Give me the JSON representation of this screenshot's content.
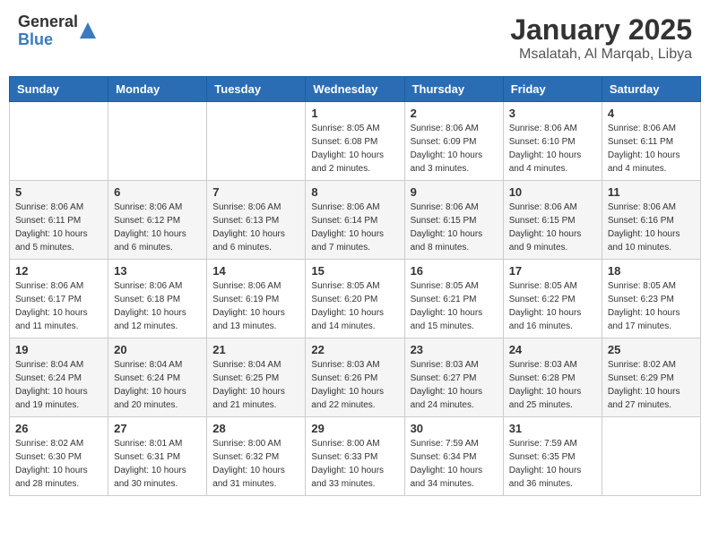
{
  "header": {
    "logo": {
      "line1": "General",
      "line2": "Blue"
    },
    "title": "January 2025",
    "subtitle": "Msalatah, Al Marqab, Libya"
  },
  "weekdays": [
    "Sunday",
    "Monday",
    "Tuesday",
    "Wednesday",
    "Thursday",
    "Friday",
    "Saturday"
  ],
  "weeks": [
    [
      {
        "day": "",
        "sunrise": "",
        "sunset": "",
        "daylight": ""
      },
      {
        "day": "",
        "sunrise": "",
        "sunset": "",
        "daylight": ""
      },
      {
        "day": "",
        "sunrise": "",
        "sunset": "",
        "daylight": ""
      },
      {
        "day": "1",
        "sunrise": "Sunrise: 8:05 AM",
        "sunset": "Sunset: 6:08 PM",
        "daylight": "Daylight: 10 hours and 2 minutes."
      },
      {
        "day": "2",
        "sunrise": "Sunrise: 8:06 AM",
        "sunset": "Sunset: 6:09 PM",
        "daylight": "Daylight: 10 hours and 3 minutes."
      },
      {
        "day": "3",
        "sunrise": "Sunrise: 8:06 AM",
        "sunset": "Sunset: 6:10 PM",
        "daylight": "Daylight: 10 hours and 4 minutes."
      },
      {
        "day": "4",
        "sunrise": "Sunrise: 8:06 AM",
        "sunset": "Sunset: 6:11 PM",
        "daylight": "Daylight: 10 hours and 4 minutes."
      }
    ],
    [
      {
        "day": "5",
        "sunrise": "Sunrise: 8:06 AM",
        "sunset": "Sunset: 6:11 PM",
        "daylight": "Daylight: 10 hours and 5 minutes."
      },
      {
        "day": "6",
        "sunrise": "Sunrise: 8:06 AM",
        "sunset": "Sunset: 6:12 PM",
        "daylight": "Daylight: 10 hours and 6 minutes."
      },
      {
        "day": "7",
        "sunrise": "Sunrise: 8:06 AM",
        "sunset": "Sunset: 6:13 PM",
        "daylight": "Daylight: 10 hours and 6 minutes."
      },
      {
        "day": "8",
        "sunrise": "Sunrise: 8:06 AM",
        "sunset": "Sunset: 6:14 PM",
        "daylight": "Daylight: 10 hours and 7 minutes."
      },
      {
        "day": "9",
        "sunrise": "Sunrise: 8:06 AM",
        "sunset": "Sunset: 6:15 PM",
        "daylight": "Daylight: 10 hours and 8 minutes."
      },
      {
        "day": "10",
        "sunrise": "Sunrise: 8:06 AM",
        "sunset": "Sunset: 6:15 PM",
        "daylight": "Daylight: 10 hours and 9 minutes."
      },
      {
        "day": "11",
        "sunrise": "Sunrise: 8:06 AM",
        "sunset": "Sunset: 6:16 PM",
        "daylight": "Daylight: 10 hours and 10 minutes."
      }
    ],
    [
      {
        "day": "12",
        "sunrise": "Sunrise: 8:06 AM",
        "sunset": "Sunset: 6:17 PM",
        "daylight": "Daylight: 10 hours and 11 minutes."
      },
      {
        "day": "13",
        "sunrise": "Sunrise: 8:06 AM",
        "sunset": "Sunset: 6:18 PM",
        "daylight": "Daylight: 10 hours and 12 minutes."
      },
      {
        "day": "14",
        "sunrise": "Sunrise: 8:06 AM",
        "sunset": "Sunset: 6:19 PM",
        "daylight": "Daylight: 10 hours and 13 minutes."
      },
      {
        "day": "15",
        "sunrise": "Sunrise: 8:05 AM",
        "sunset": "Sunset: 6:20 PM",
        "daylight": "Daylight: 10 hours and 14 minutes."
      },
      {
        "day": "16",
        "sunrise": "Sunrise: 8:05 AM",
        "sunset": "Sunset: 6:21 PM",
        "daylight": "Daylight: 10 hours and 15 minutes."
      },
      {
        "day": "17",
        "sunrise": "Sunrise: 8:05 AM",
        "sunset": "Sunset: 6:22 PM",
        "daylight": "Daylight: 10 hours and 16 minutes."
      },
      {
        "day": "18",
        "sunrise": "Sunrise: 8:05 AM",
        "sunset": "Sunset: 6:23 PM",
        "daylight": "Daylight: 10 hours and 17 minutes."
      }
    ],
    [
      {
        "day": "19",
        "sunrise": "Sunrise: 8:04 AM",
        "sunset": "Sunset: 6:24 PM",
        "daylight": "Daylight: 10 hours and 19 minutes."
      },
      {
        "day": "20",
        "sunrise": "Sunrise: 8:04 AM",
        "sunset": "Sunset: 6:24 PM",
        "daylight": "Daylight: 10 hours and 20 minutes."
      },
      {
        "day": "21",
        "sunrise": "Sunrise: 8:04 AM",
        "sunset": "Sunset: 6:25 PM",
        "daylight": "Daylight: 10 hours and 21 minutes."
      },
      {
        "day": "22",
        "sunrise": "Sunrise: 8:03 AM",
        "sunset": "Sunset: 6:26 PM",
        "daylight": "Daylight: 10 hours and 22 minutes."
      },
      {
        "day": "23",
        "sunrise": "Sunrise: 8:03 AM",
        "sunset": "Sunset: 6:27 PM",
        "daylight": "Daylight: 10 hours and 24 minutes."
      },
      {
        "day": "24",
        "sunrise": "Sunrise: 8:03 AM",
        "sunset": "Sunset: 6:28 PM",
        "daylight": "Daylight: 10 hours and 25 minutes."
      },
      {
        "day": "25",
        "sunrise": "Sunrise: 8:02 AM",
        "sunset": "Sunset: 6:29 PM",
        "daylight": "Daylight: 10 hours and 27 minutes."
      }
    ],
    [
      {
        "day": "26",
        "sunrise": "Sunrise: 8:02 AM",
        "sunset": "Sunset: 6:30 PM",
        "daylight": "Daylight: 10 hours and 28 minutes."
      },
      {
        "day": "27",
        "sunrise": "Sunrise: 8:01 AM",
        "sunset": "Sunset: 6:31 PM",
        "daylight": "Daylight: 10 hours and 30 minutes."
      },
      {
        "day": "28",
        "sunrise": "Sunrise: 8:00 AM",
        "sunset": "Sunset: 6:32 PM",
        "daylight": "Daylight: 10 hours and 31 minutes."
      },
      {
        "day": "29",
        "sunrise": "Sunrise: 8:00 AM",
        "sunset": "Sunset: 6:33 PM",
        "daylight": "Daylight: 10 hours and 33 minutes."
      },
      {
        "day": "30",
        "sunrise": "Sunrise: 7:59 AM",
        "sunset": "Sunset: 6:34 PM",
        "daylight": "Daylight: 10 hours and 34 minutes."
      },
      {
        "day": "31",
        "sunrise": "Sunrise: 7:59 AM",
        "sunset": "Sunset: 6:35 PM",
        "daylight": "Daylight: 10 hours and 36 minutes."
      },
      {
        "day": "",
        "sunrise": "",
        "sunset": "",
        "daylight": ""
      }
    ]
  ]
}
